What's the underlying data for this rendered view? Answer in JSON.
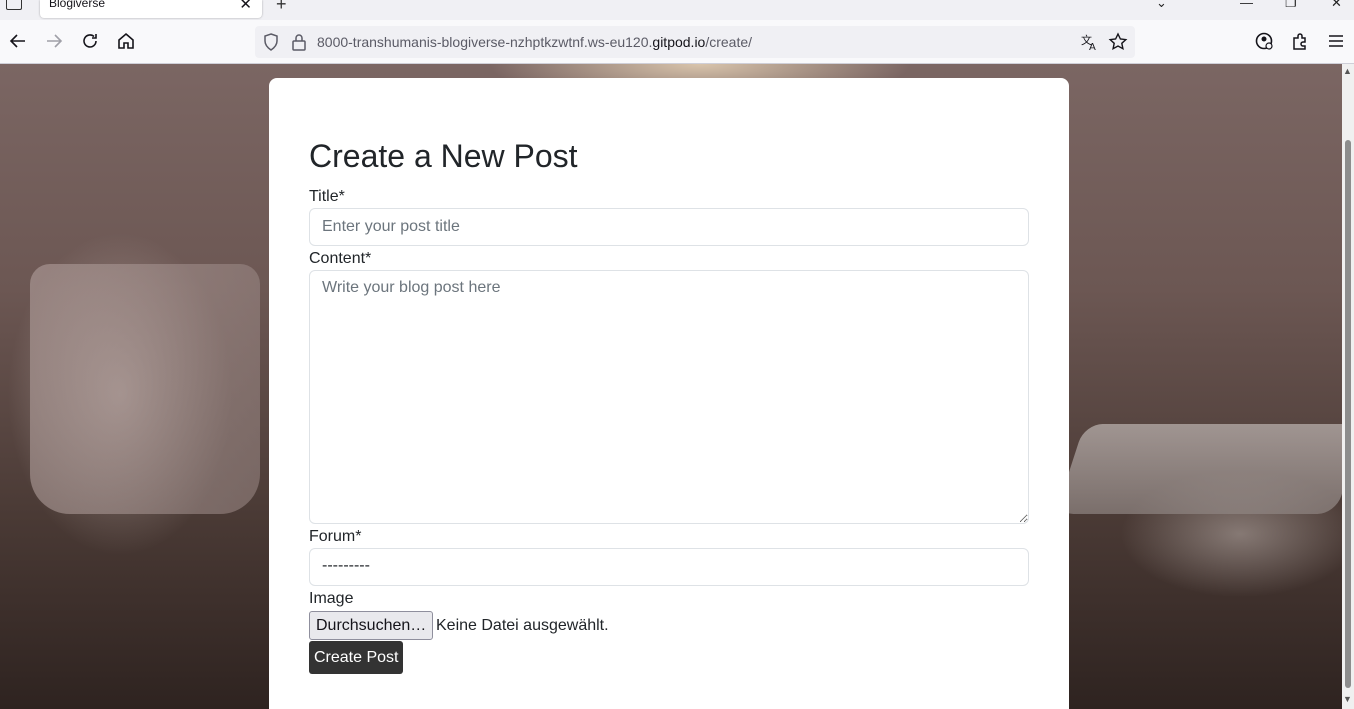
{
  "browser": {
    "tab_title": "Blogiverse",
    "tab_close": "✕",
    "new_tab": "+",
    "url_prefix": "8000-transhumanis-blogiverse-nzhptkzwtnf.ws-eu120.",
    "url_domain": "gitpod.io",
    "url_path": "/create/"
  },
  "form": {
    "heading": "Create a New Post",
    "title_label": "Title*",
    "title_placeholder": "Enter your post title",
    "content_label": "Content*",
    "content_placeholder": "Write your blog post here",
    "forum_label": "Forum*",
    "forum_selected": "---------",
    "image_label": "Image",
    "file_button": "Durchsuchen…",
    "file_status": "Keine Datei ausgewählt.",
    "submit_label": "Create Post"
  }
}
